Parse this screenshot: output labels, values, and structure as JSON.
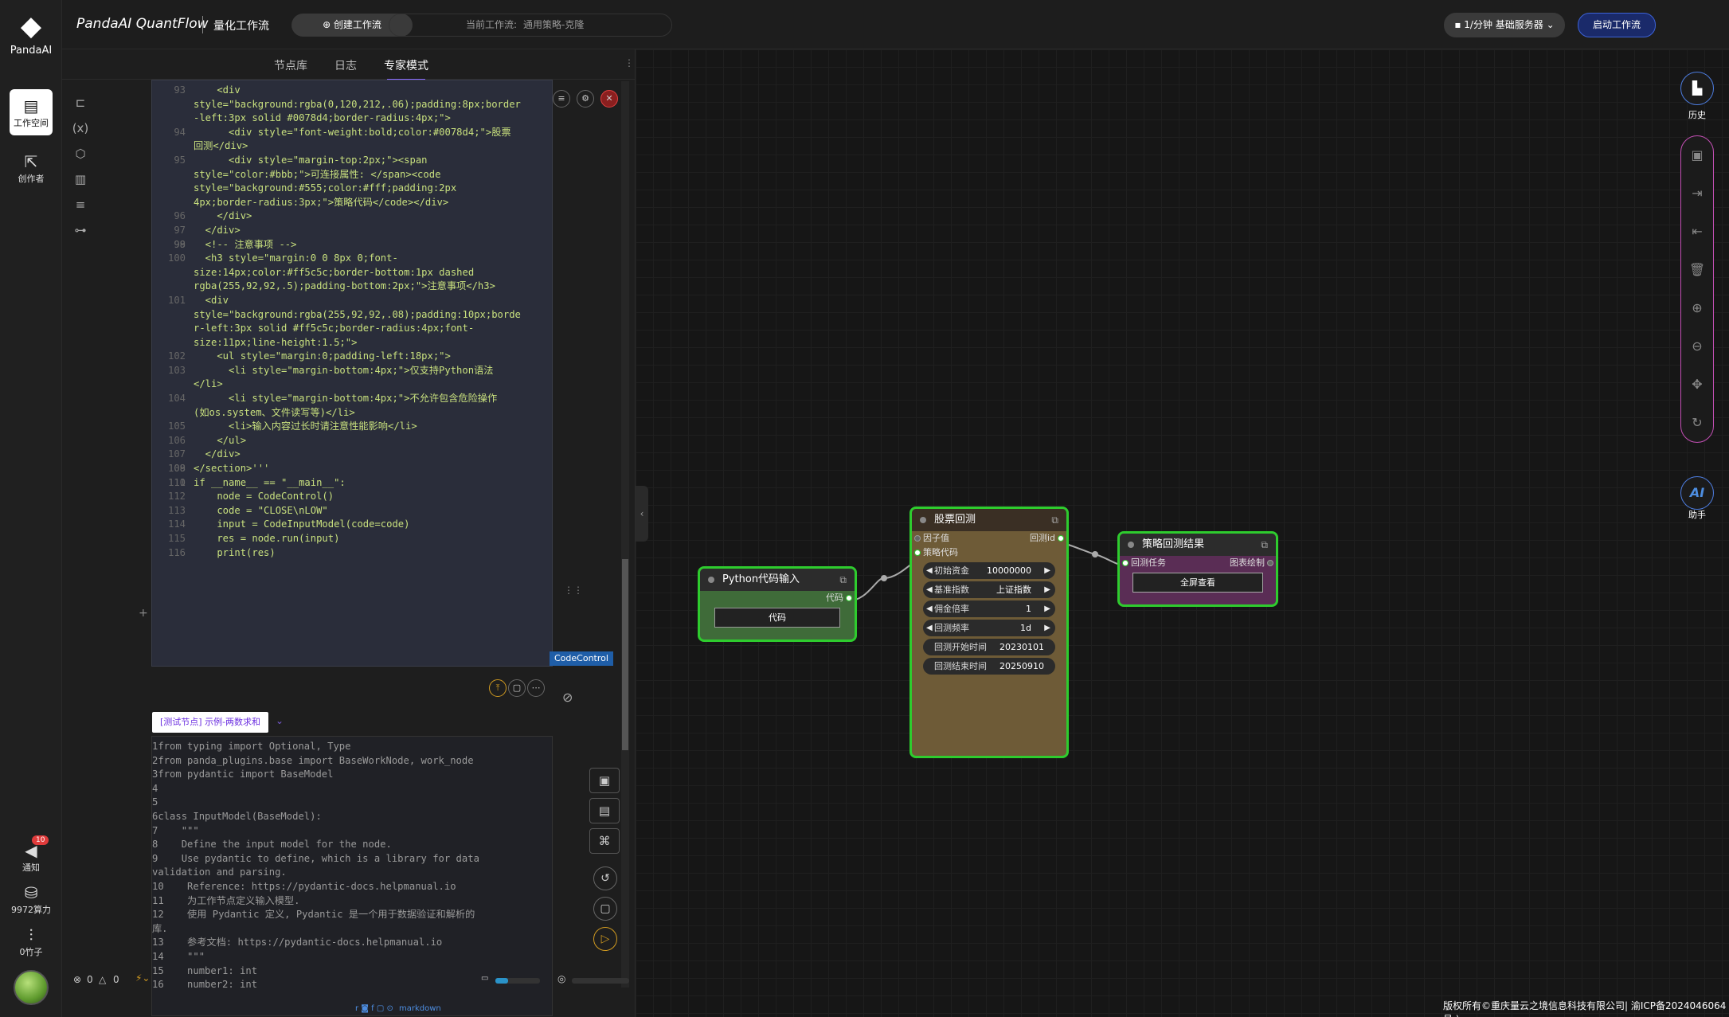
{
  "brand": {
    "logo_text": "PandaAI"
  },
  "header": {
    "app_title": "PandaAI QuantFlow",
    "subtitle": "量化工作流",
    "create_btn": "⊕ 创建工作流",
    "current_label": "当前工作流:",
    "current_value": "通用策略-克隆",
    "server": "▪ 1/分钟  基础服务器 ⌄",
    "start_btn": "启动工作流"
  },
  "left_rail": {
    "workspace": "工作空间",
    "creator": "创作者",
    "notify": "通知",
    "notify_count": "10",
    "compute": "9972算力",
    "bamboo": "0竹子"
  },
  "panel": {
    "tabs": [
      "节点库",
      "日志",
      "专家模式"
    ],
    "codecontrol_tag": "CodeControl",
    "node_tag": "[测试节点] 示例-两数求和",
    "markdown_label": "markdown",
    "status_errors": "0",
    "status_warnings": "0"
  },
  "code_lines": [
    {
      "n": "93",
      "t": "    <div"
    },
    {
      "n": "",
      "t": "style=\"background:rgba(0,120,212,.06);padding:8px;border"
    },
    {
      "n": "",
      "t": "-left:3px solid #0078d4;border-radius:4px;\">"
    },
    {
      "n": "94",
      "t": "      <div style=\"font-weight:bold;color:#0078d4;\">股票"
    },
    {
      "n": "",
      "t": "回测</div>"
    },
    {
      "n": "95",
      "t": "      <div style=\"margin-top:2px;\"><span"
    },
    {
      "n": "",
      "t": "style=\"color:#bbb;\">可连接属性: </span><code"
    },
    {
      "n": "",
      "t": "style=\"background:#555;color:#fff;padding:2px"
    },
    {
      "n": "",
      "t": "4px;border-radius:3px;\">策略代码</code></div>"
    },
    {
      "n": "96",
      "t": "    </div>"
    },
    {
      "n": "97",
      "t": "  </div>"
    },
    {
      "n": "98",
      "t": ""
    },
    {
      "n": "99",
      "t": "  <!-- 注意事项 -->"
    },
    {
      "n": "100",
      "t": "  <h3 style=\"margin:0 0 8px 0;font-"
    },
    {
      "n": "",
      "t": "size:14px;color:#ff5c5c;border-bottom:1px dashed"
    },
    {
      "n": "",
      "t": "rgba(255,92,92,.5);padding-bottom:2px;\">注意事项</h3>"
    },
    {
      "n": "101",
      "t": "  <div"
    },
    {
      "n": "",
      "t": "style=\"background:rgba(255,92,92,.08);padding:10px;borde"
    },
    {
      "n": "",
      "t": "r-left:3px solid #ff5c5c;border-radius:4px;font-"
    },
    {
      "n": "",
      "t": "size:11px;line-height:1.5;\">"
    },
    {
      "n": "102",
      "t": "    <ul style=\"margin:0;padding-left:18px;\">"
    },
    {
      "n": "103",
      "t": "      <li style=\"margin-bottom:4px;\">仅支持Python语法"
    },
    {
      "n": "",
      "t": "</li>"
    },
    {
      "n": "104",
      "t": "      <li style=\"margin-bottom:4px;\">不允许包含危险操作"
    },
    {
      "n": "",
      "t": "(如os.system、文件读写等)</li>"
    },
    {
      "n": "105",
      "t": "      <li>输入内容过长时请注意性能影响</li>"
    },
    {
      "n": "106",
      "t": "    </ul>"
    },
    {
      "n": "107",
      "t": "  </div>"
    },
    {
      "n": "108",
      "t": ""
    },
    {
      "n": "109",
      "t": "</section>'''"
    },
    {
      "n": "110",
      "t": ""
    },
    {
      "n": "111",
      "t": "if __name__ == \"__main__\":"
    },
    {
      "n": "112",
      "t": "    node = CodeControl()"
    },
    {
      "n": "113",
      "t": "    code = \"CLOSE\\nLOW\""
    },
    {
      "n": "114",
      "t": "    input = CodeInputModel(code=code)"
    },
    {
      "n": "115",
      "t": "    res = node.run(input)"
    },
    {
      "n": "116",
      "t": "    print(res)"
    }
  ],
  "code_lines2": [
    {
      "n": "1",
      "t": "from typing import Optional, Type"
    },
    {
      "n": "2",
      "t": "from panda_plugins.base import BaseWorkNode, work_node"
    },
    {
      "n": "3",
      "t": "from pydantic import BaseModel"
    },
    {
      "n": "4",
      "t": ""
    },
    {
      "n": "5",
      "t": ""
    },
    {
      "n": "6",
      "t": "class InputModel(BaseModel):"
    },
    {
      "n": "7",
      "t": "    \"\"\""
    },
    {
      "n": "8",
      "t": "    Define the input model for the node."
    },
    {
      "n": "9",
      "t": "    Use pydantic to define, which is a library for data"
    },
    {
      "n": "",
      "t": "validation and parsing."
    },
    {
      "n": "10",
      "t": "    Reference: https://pydantic-docs.helpmanual.io"
    },
    {
      "n": "11",
      "t": "    为工作节点定义输入模型."
    },
    {
      "n": "12",
      "t": "    使用 Pydantic 定义, Pydantic 是一个用于数据验证和解析的"
    },
    {
      "n": "",
      "t": "库."
    },
    {
      "n": "13",
      "t": "    参考文档: https://pydantic-docs.helpmanual.io"
    },
    {
      "n": "14",
      "t": "    \"\"\""
    },
    {
      "n": "15",
      "t": "    number1: int"
    },
    {
      "n": "16",
      "t": "    number2: int"
    }
  ],
  "nodes": {
    "python": {
      "title": "Python代码输入",
      "out_port": "代码",
      "button": "代码"
    },
    "backtest": {
      "title": "股票回测",
      "port_in1": "因子值",
      "port_out1": "回测id",
      "port_in2": "策略代码",
      "fields": [
        {
          "label": "初始资金",
          "value": "10000000",
          "arrows": true
        },
        {
          "label": "基准指数",
          "value": "上证指数",
          "arrows": true
        },
        {
          "label": "佣金倍率",
          "value": "1",
          "arrows": true
        },
        {
          "label": "回测频率",
          "value": "1d",
          "arrows": true
        },
        {
          "label": "回测开始时间",
          "value": "20230101",
          "arrows": false
        },
        {
          "label": "回测结束时间",
          "value": "20250910",
          "arrows": false
        }
      ]
    },
    "result": {
      "title": "策略回测结果",
      "port_in": "回测任务",
      "port_out": "图表绘制",
      "button": "全屏查看"
    }
  },
  "right_tools": {
    "history": "历史",
    "assistant_icon": "AI",
    "assistant": "助手"
  },
  "footer": "版权所有©重庆量云之境信息科技有限公司| 渝ICP备2024046064号 )"
}
